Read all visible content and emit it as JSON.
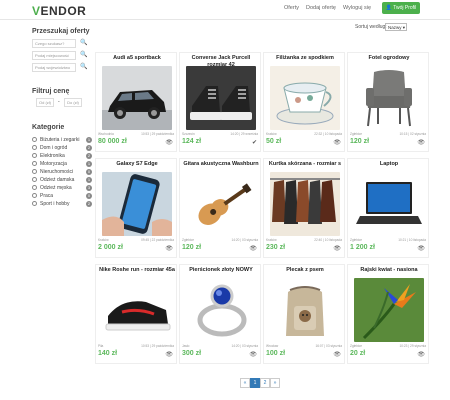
{
  "header": {
    "logo_v": "V",
    "logo_rest": "ENDOR",
    "nav": [
      "Oferty",
      "Dodaj ofertę",
      "Wyloguj się"
    ],
    "profile_button": "Twój Profil"
  },
  "sidebar": {
    "search_title": "Przeszukaj oferty",
    "search_placeholder": "Czego szukasz?",
    "city_placeholder": "Podaj miejscowość",
    "region_placeholder": "Podaj województwo",
    "price_title": "Filtruj cenę",
    "price_from": "Od (zł)",
    "price_sep": "-",
    "price_to": "Do (zł)",
    "categories_title": "Kategorie",
    "categories": [
      {
        "label": "Biżuteria i zegarki",
        "count": "1"
      },
      {
        "label": "Dom i ogród",
        "count": "2"
      },
      {
        "label": "Elektronika",
        "count": "2"
      },
      {
        "label": "Motoryzacja",
        "count": "1"
      },
      {
        "label": "Nieruchomości",
        "count": "0"
      },
      {
        "label": "Odzież damska",
        "count": "1"
      },
      {
        "label": "Odzież męska",
        "count": "3"
      },
      {
        "label": "Praca",
        "count": "0"
      },
      {
        "label": "Sport i hobby",
        "count": "2"
      }
    ]
  },
  "sort": {
    "label": "Sortuj według:",
    "selected": "Nazwy ▾"
  },
  "listings": [
    {
      "title": "Audi a5 sportback",
      "meta_l": "Wschodnia",
      "meta_r": "10:53 | 29 października",
      "price": "80 000 zł",
      "status_icon": "eye-icon"
    },
    {
      "title": "Converse Jack Purcell rozmiar 42",
      "meta_l": "Szczecin",
      "meta_r": "14:20 | 29 września",
      "price": "124 zł",
      "status_icon": "check-icon"
    },
    {
      "title": "Filiżanka ze spodkiem",
      "meta_l": "Kraków",
      "meta_r": "22:32 | 10 listopada",
      "price": "50 zł",
      "status_icon": "eye-icon"
    },
    {
      "title": "Fotel ogrodowy",
      "meta_l": "Zgłebice",
      "meta_r": "10:15 | 02 stycznia",
      "price": "120 zł",
      "status_icon": "eye-icon"
    },
    {
      "title": "Galaxy S7 Edge",
      "meta_l": "Kraków",
      "meta_r": "09:45 | 22 października",
      "price": "2 000 zł",
      "status_icon": "eye-icon"
    },
    {
      "title": "Gitara akustyczna Washburn",
      "meta_l": "Zgłebice",
      "meta_r": "14:20 | 03 stycznia",
      "price": "120 zł",
      "status_icon": "eye-icon"
    },
    {
      "title": "Kurtka skórzana - rozmiar s",
      "meta_l": "Kraków",
      "meta_r": "22:40 | 10 listopada",
      "price": "230 zł",
      "status_icon": "eye-icon"
    },
    {
      "title": "Laptop",
      "meta_l": "Zgłebice",
      "meta_r": "10:21 | 10 listopada",
      "price": "1 200 zł",
      "status_icon": "eye-icon"
    },
    {
      "title": "Nike Roshe run - rozmiar 45a",
      "meta_l": "Piła",
      "meta_r": "10:53 | 29 października",
      "price": "140 zł",
      "status_icon": "eye-icon"
    },
    {
      "title": "Pierścionek złoty NOWY",
      "meta_l": "Jasło",
      "meta_r": "14:20 | 03 stycznia",
      "price": "300 zł",
      "status_icon": "eye-icon"
    },
    {
      "title": "Plecak z psem",
      "meta_l": "Wrocław",
      "meta_r": "16:07 | 03 stycznia",
      "price": "100 zł",
      "status_icon": "eye-icon"
    },
    {
      "title": "Rajski kwiat - nasiona",
      "meta_l": "Zgłebice",
      "meta_r": "10:23 | 29 stycznia",
      "price": "20 zł",
      "status_icon": "eye-icon"
    }
  ],
  "pagination": {
    "prev": "«",
    "pages": [
      "1",
      "2"
    ],
    "next": "»",
    "active": "1"
  },
  "colors": {
    "accent": "#4cb04c",
    "price": "#5cb85c",
    "link": "#337ab7"
  }
}
